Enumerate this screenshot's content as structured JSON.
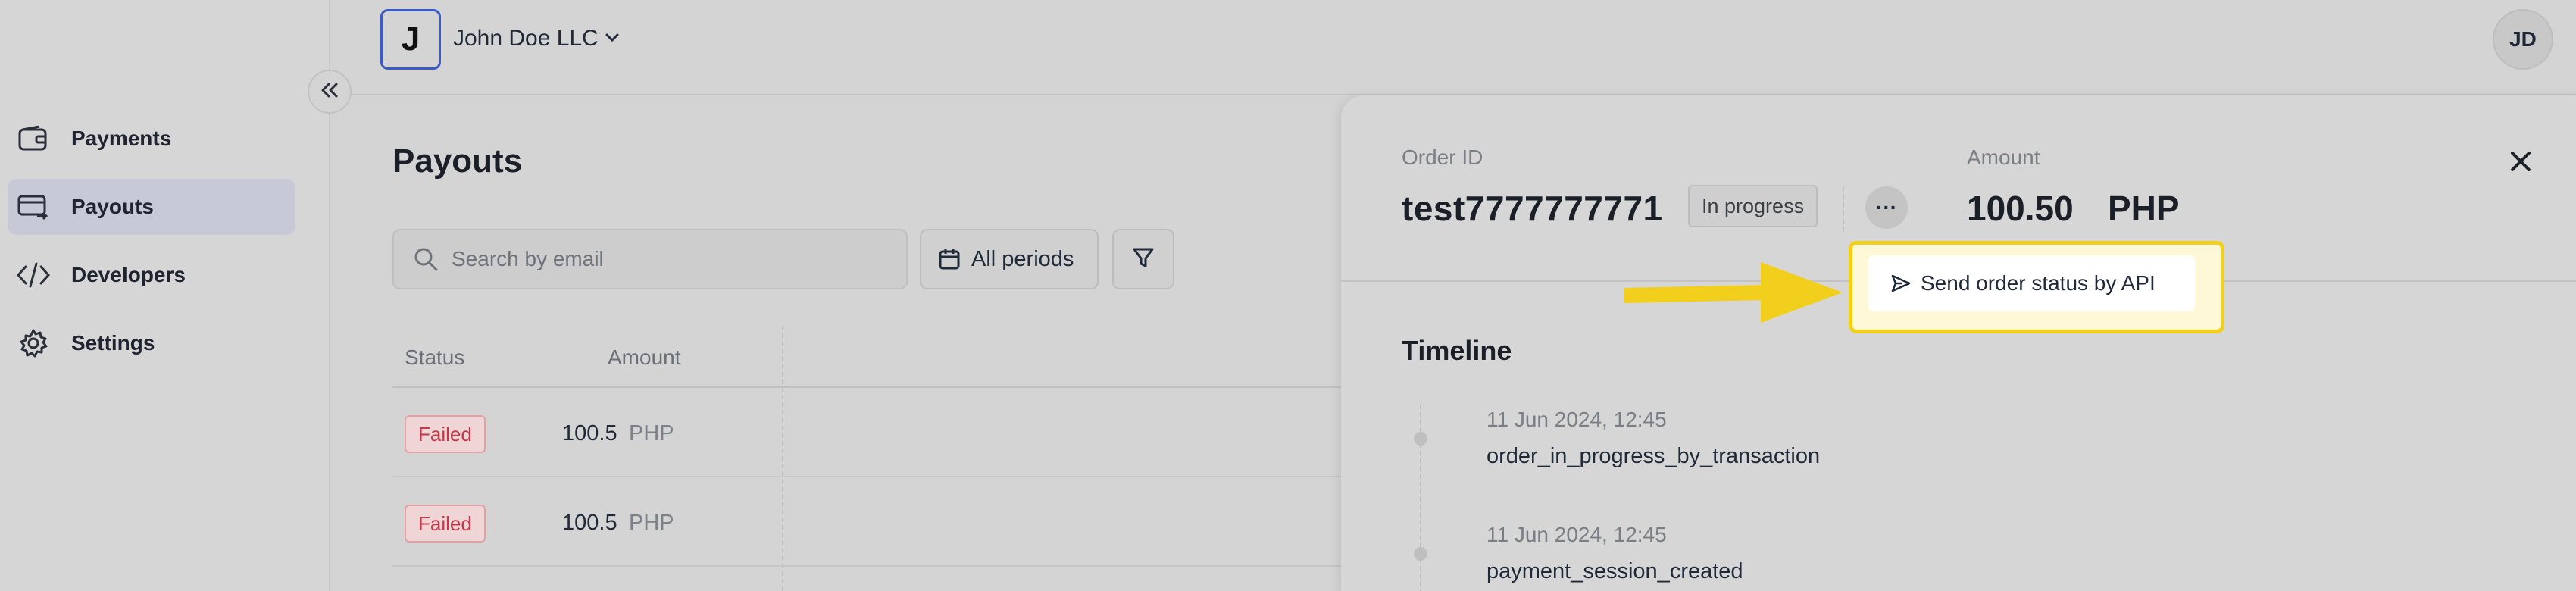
{
  "sidebar": {
    "items": [
      {
        "label": "Payments",
        "icon": "wallet-icon"
      },
      {
        "label": "Payouts",
        "icon": "card-transfer-icon",
        "active": true
      },
      {
        "label": "Developers",
        "icon": "code-icon"
      },
      {
        "label": "Settings",
        "icon": "gear-icon"
      }
    ],
    "collapse_icon": "chevrons-left-icon"
  },
  "topbar": {
    "org_initial": "J",
    "org_name": "John Doe LLC",
    "user_initials": "JD"
  },
  "main": {
    "title": "Payouts",
    "search_placeholder": "Search by email",
    "periods_label": "All periods",
    "columns": [
      "Status",
      "Amount"
    ],
    "rows": [
      {
        "status": "Failed",
        "amount": "100.5",
        "currency": "PHP"
      },
      {
        "status": "Failed",
        "amount": "100.5",
        "currency": "PHP"
      }
    ]
  },
  "drawer": {
    "order_label": "Order ID",
    "order_id": "test7777777771",
    "order_status": "In progress",
    "more_label": "···",
    "amount_label": "Amount",
    "amount_value": "100.50",
    "amount_currency": "PHP",
    "timeline_title": "Timeline",
    "timeline": [
      {
        "date": "11 Jun 2024, 12:45",
        "event": "order_in_progress_by_transaction"
      },
      {
        "date": "11 Jun 2024, 12:45",
        "event": "payment_session_created"
      }
    ]
  },
  "popover": {
    "action_label": "Send order status by API",
    "icon": "send-icon"
  },
  "colors": {
    "highlight": "#f2cf1d",
    "failed_text": "#c23a49",
    "active_nav": "#c7cad6"
  }
}
